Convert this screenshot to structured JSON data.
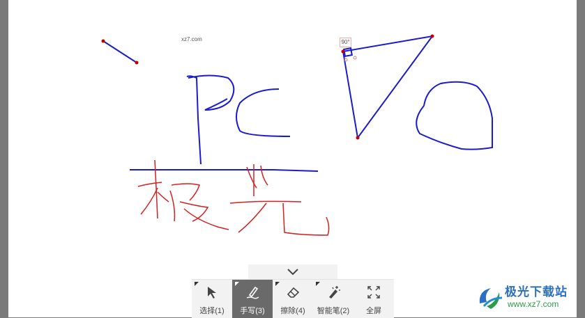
{
  "canvas": {
    "watermark_text": "xz7.com",
    "angle_label": "90°",
    "background_color": "#ffffff",
    "ink_colors": {
      "blue": "#1a1ad0",
      "red": "#d42020",
      "point": "#c00000"
    }
  },
  "toolbar": {
    "collapse_icon": "chevron-down-icon",
    "tools": [
      {
        "id": "select",
        "label": "选择(1)",
        "icon": "cursor-arrow-icon",
        "active": false
      },
      {
        "id": "handwrite",
        "label": "手写(3)",
        "icon": "pen-icon",
        "active": true
      },
      {
        "id": "erase",
        "label": "擦除(4)",
        "icon": "eraser-icon",
        "active": false
      },
      {
        "id": "smartpen",
        "label": "智能笔(2)",
        "icon": "magic-pen-icon",
        "active": false
      },
      {
        "id": "fullscreen",
        "label": "全屏",
        "icon": "fullscreen-icon",
        "active": false
      }
    ]
  },
  "brand": {
    "name": "极光下载站",
    "url": "www.xz7.com",
    "logo_icon": "aurora-logo-icon"
  }
}
